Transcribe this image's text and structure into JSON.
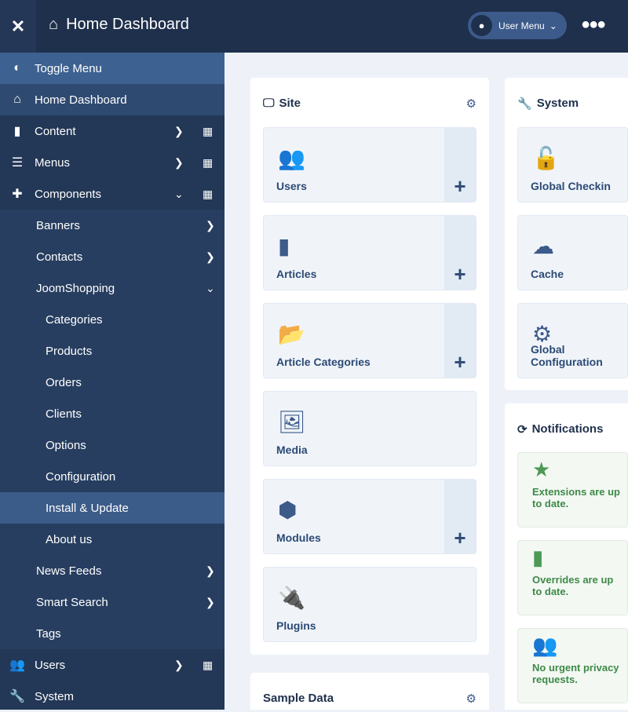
{
  "header": {
    "title": "Home Dashboard",
    "user_menu": "User Menu"
  },
  "sidebar": {
    "items": [
      {
        "label": "Toggle Menu",
        "icon": "toggle-icon"
      },
      {
        "label": "Home Dashboard",
        "icon": "home-icon"
      },
      {
        "label": "Content",
        "icon": "file-icon"
      },
      {
        "label": "Menus",
        "icon": "list-icon"
      },
      {
        "label": "Components",
        "icon": "puzzle-icon"
      },
      {
        "label": "Banners"
      },
      {
        "label": "Contacts"
      },
      {
        "label": "JoomShopping"
      },
      {
        "label": "Categories"
      },
      {
        "label": "Products"
      },
      {
        "label": "Orders"
      },
      {
        "label": "Clients"
      },
      {
        "label": "Options"
      },
      {
        "label": "Configuration"
      },
      {
        "label": "Install & Update"
      },
      {
        "label": "About us"
      },
      {
        "label": "News Feeds"
      },
      {
        "label": "Smart Search"
      },
      {
        "label": "Tags"
      },
      {
        "label": "Users",
        "icon": "users-icon"
      },
      {
        "label": "System",
        "icon": "wrench-icon"
      }
    ]
  },
  "site": {
    "title": "Site",
    "tiles": [
      {
        "label": "Users"
      },
      {
        "label": "Articles"
      },
      {
        "label": "Article Categories"
      },
      {
        "label": "Media"
      },
      {
        "label": "Modules"
      },
      {
        "label": "Plugins"
      }
    ]
  },
  "system": {
    "title": "System",
    "tiles": [
      {
        "label": "Global Checkin"
      },
      {
        "label": "Cache"
      },
      {
        "label": "Global Configuration"
      }
    ]
  },
  "notifications": {
    "title": "Notifications",
    "items": [
      {
        "label": "Extensions are up to date."
      },
      {
        "label": "Overrides are up to date."
      },
      {
        "label": "No urgent privacy requests."
      }
    ]
  },
  "sample": {
    "title": "Sample Data"
  },
  "colors": {
    "header": "#1f304c",
    "sidebar": "#233756",
    "accent": "#3c5a8a",
    "success": "#4c9a55"
  }
}
